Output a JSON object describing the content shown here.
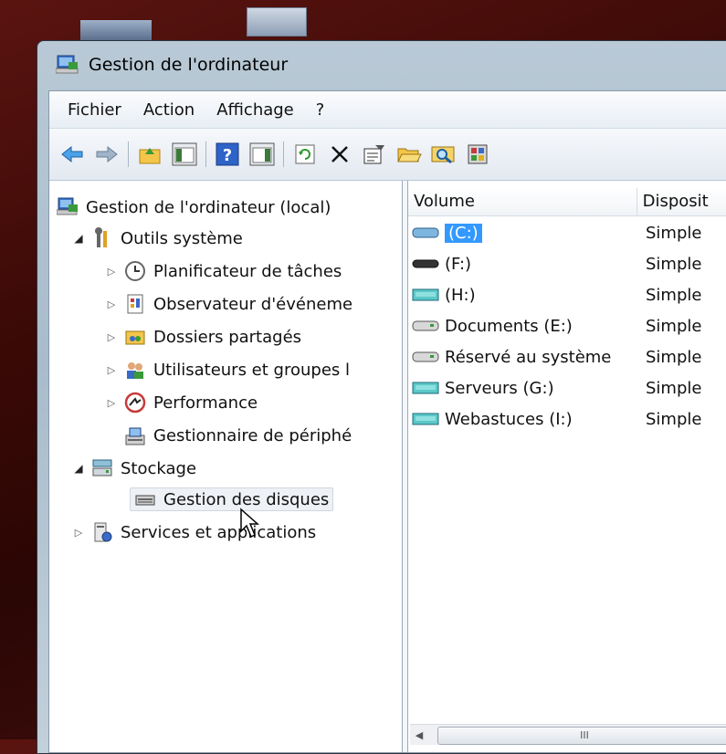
{
  "window": {
    "title": "Gestion de l'ordinateur"
  },
  "menu": [
    "Fichier",
    "Action",
    "Affichage",
    "?"
  ],
  "toolbar": {
    "icons": [
      "back-icon",
      "forward-icon",
      "up-folder-icon",
      "show-hide-tree-icon",
      "help-icon",
      "show-hide-action-icon",
      "refresh-icon",
      "delete-icon",
      "properties-icon",
      "open-icon",
      "search-icon",
      "disk-tool-icon"
    ]
  },
  "tree": {
    "root": "Gestion de l'ordinateur (local)",
    "outils": "Outils système",
    "planificateur": "Planificateur de tâches",
    "observateur": "Observateur d'événeme",
    "dossiers": "Dossiers partagés",
    "utilisateurs": "Utilisateurs et groupes l",
    "performance": "Performance",
    "gestionnaire": "Gestionnaire de périphé",
    "stockage": "Stockage",
    "disques": "Gestion des disques",
    "services": "Services et applications"
  },
  "list": {
    "columns": [
      "Volume",
      "Disposit"
    ],
    "rows": [
      {
        "volume": "(C:)",
        "disposition": "Simple"
      },
      {
        "volume": "(F:)",
        "disposition": "Simple"
      },
      {
        "volume": "(H:)",
        "disposition": "Simple"
      },
      {
        "volume": "Documents (E:)",
        "disposition": "Simple"
      },
      {
        "volume": "Réservé au système",
        "disposition": "Simple"
      },
      {
        "volume": "Serveurs (G:)",
        "disposition": "Simple"
      },
      {
        "volume": "Webastuces (I:)",
        "disposition": "Simple"
      }
    ],
    "scroll_label": "III"
  },
  "colors": {
    "selection": "#3399ff",
    "titlebar": "#b9c9d6"
  }
}
